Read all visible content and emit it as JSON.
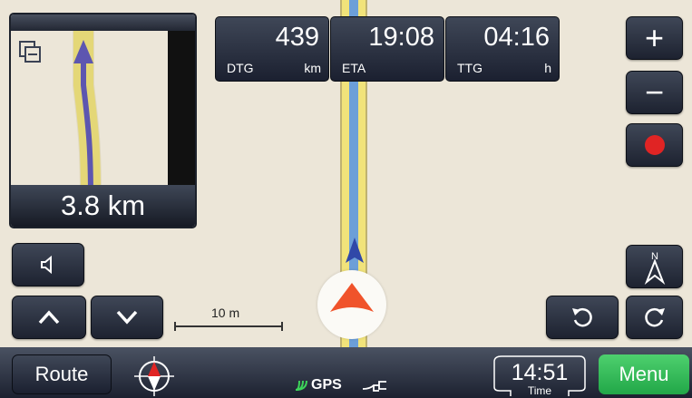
{
  "preview": {
    "distance": "3.8 km",
    "icon": "layers-icon"
  },
  "info_panels": [
    {
      "value": "439",
      "label": "DTG",
      "unit": "km"
    },
    {
      "value": "19:08",
      "label": "ETA",
      "unit": ""
    },
    {
      "value": "04:16",
      "label": "TTG",
      "unit": "h"
    }
  ],
  "controls": {
    "zoom_in": "+",
    "zoom_out": "−",
    "record_icon": "record-icon",
    "volume_icon": "speaker-icon",
    "compass_label": "N"
  },
  "scale": {
    "label": "10 m"
  },
  "bottom": {
    "route_label": "Route",
    "menu_label": "Menu",
    "time_value": "14:51",
    "time_label": "Time",
    "gps_label": "GPS"
  },
  "colors": {
    "menu_green": "#22a748",
    "nav_arrow": "#f0532b",
    "route_blue": "#6c9fd8",
    "road_yellow": "#f1e37a"
  }
}
